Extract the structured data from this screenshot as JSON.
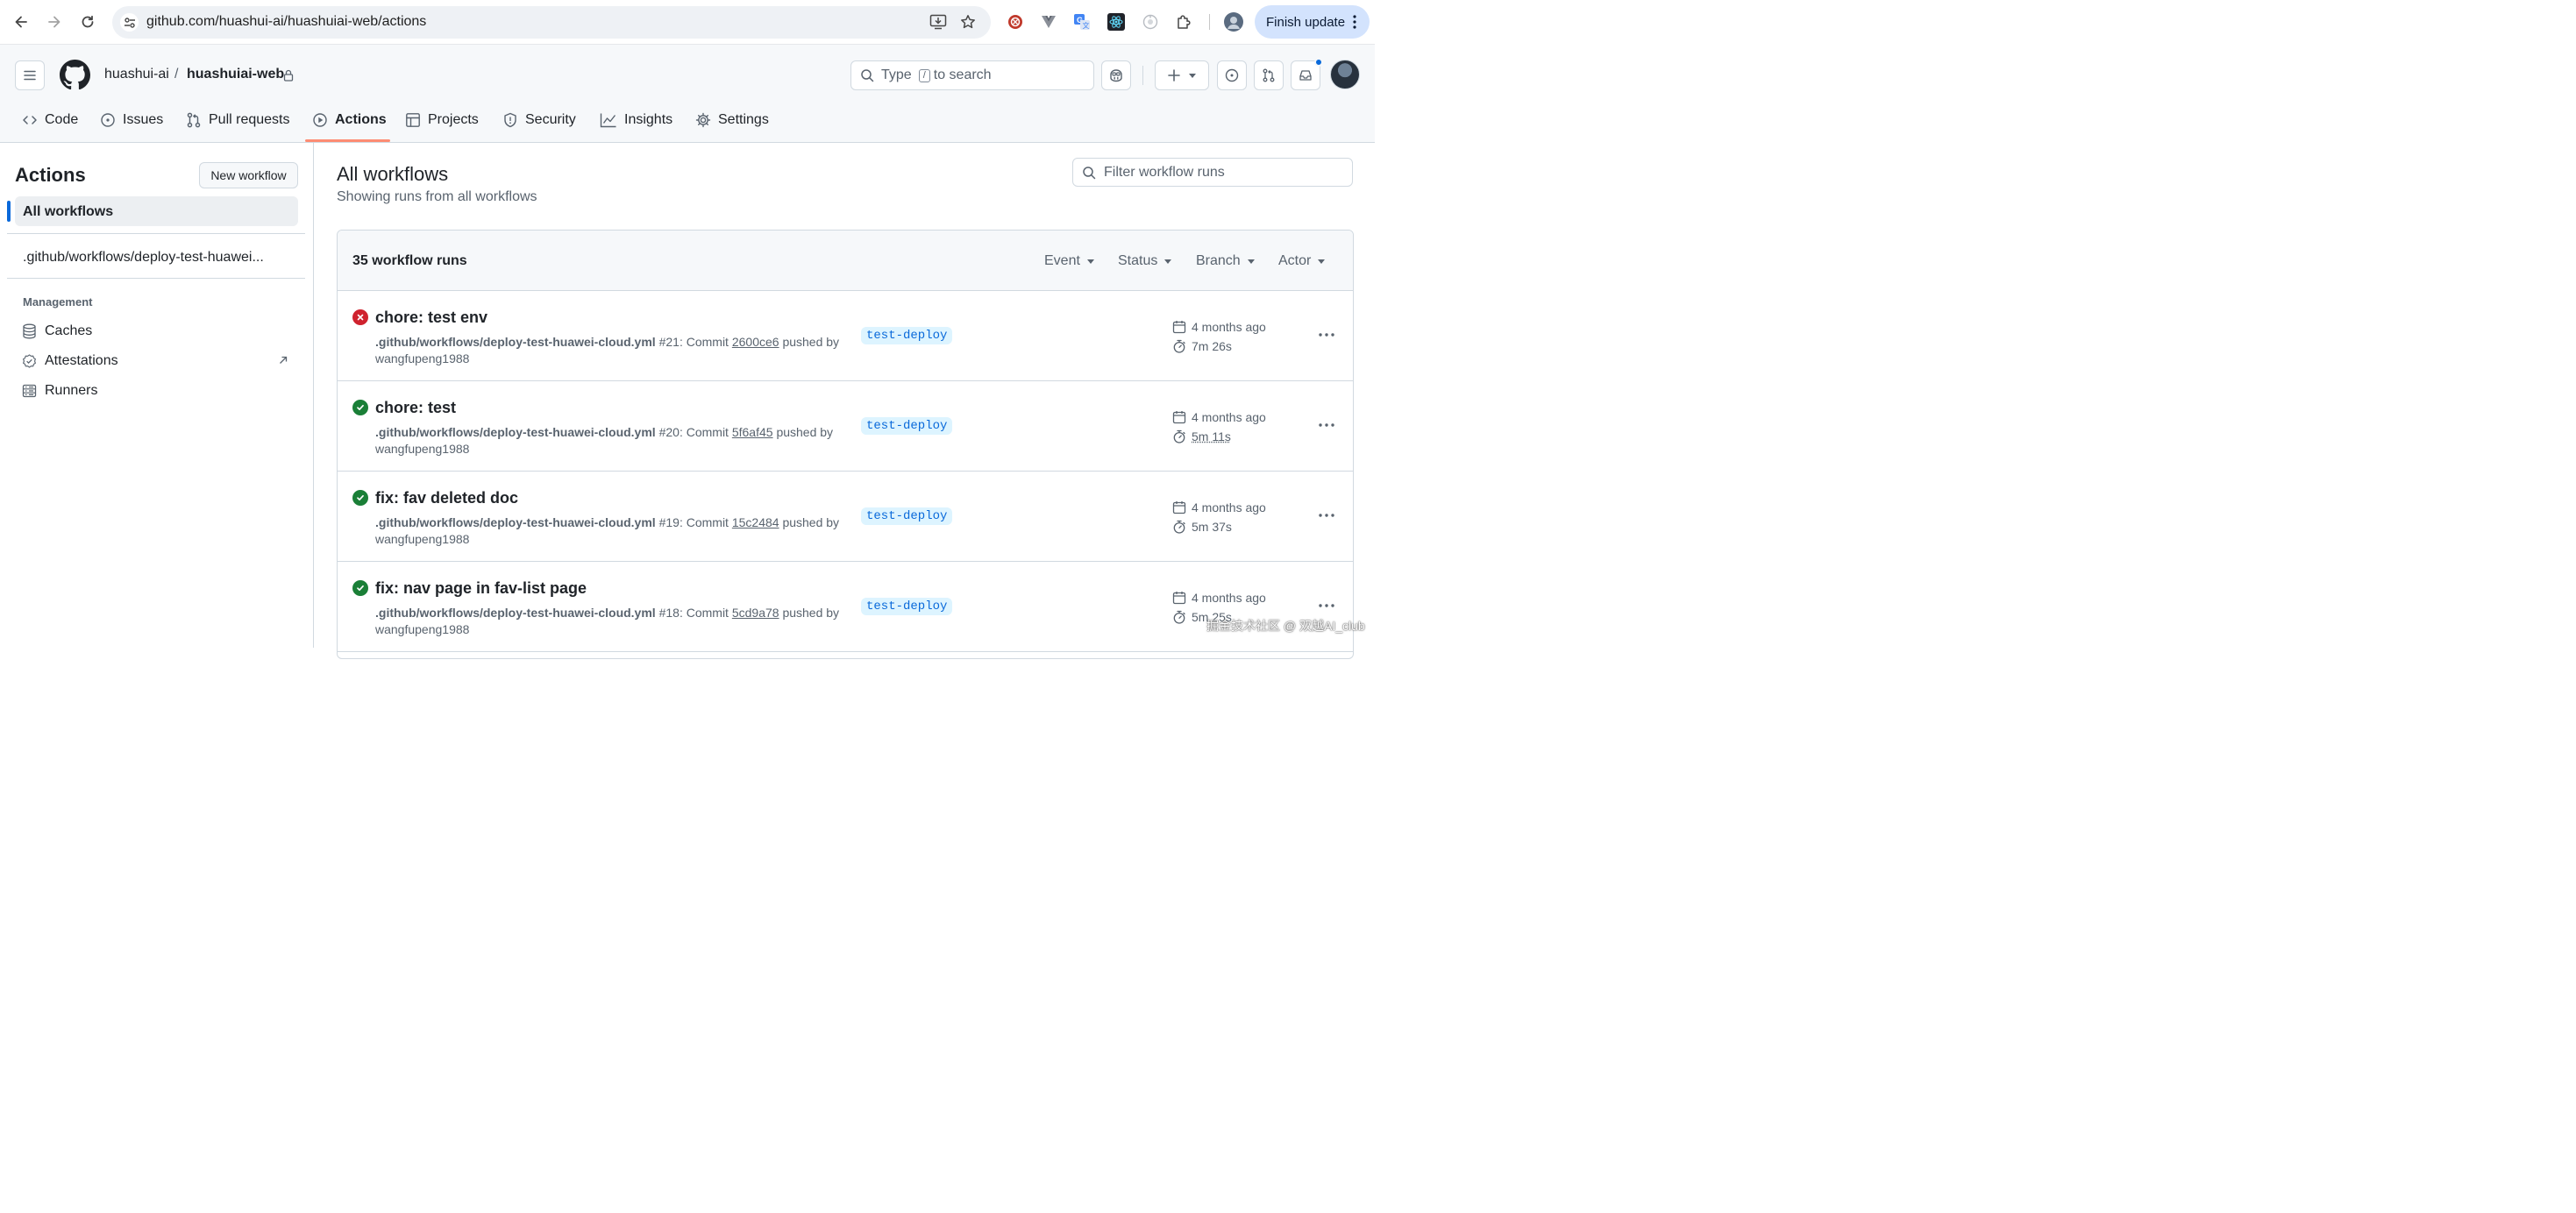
{
  "browser": {
    "url": "github.com/huashui-ai/huashuiai-web/actions",
    "finish_update_label": "Finish update"
  },
  "header": {
    "owner": "huashui-ai",
    "separator": "/",
    "repo": "huashuiai-web",
    "search_prefix": "Type",
    "search_key": "/",
    "search_suffix": "to search"
  },
  "tabs": [
    {
      "label": "Code",
      "icon": "code-icon"
    },
    {
      "label": "Issues",
      "icon": "issue-icon"
    },
    {
      "label": "Pull requests",
      "icon": "pull-request-icon"
    },
    {
      "label": "Actions",
      "icon": "play-icon",
      "active": true
    },
    {
      "label": "Projects",
      "icon": "table-icon"
    },
    {
      "label": "Security",
      "icon": "shield-icon"
    },
    {
      "label": "Insights",
      "icon": "graph-icon"
    },
    {
      "label": "Settings",
      "icon": "gear-icon"
    }
  ],
  "sidebar": {
    "title": "Actions",
    "new_workflow_label": "New workflow",
    "all_workflows_label": "All workflows",
    "workflow_item": ".github/workflows/deploy-test-huawei...",
    "management_label": "Management",
    "management_items": [
      {
        "label": "Caches",
        "icon": "database-icon"
      },
      {
        "label": "Attestations",
        "icon": "verified-icon",
        "external": true
      },
      {
        "label": "Runners",
        "icon": "server-icon"
      }
    ]
  },
  "main": {
    "title": "All workflows",
    "subtitle": "Showing runs from all workflows",
    "filter_placeholder": "Filter workflow runs",
    "runs_count": "35 workflow runs",
    "filters": [
      "Event",
      "Status",
      "Branch",
      "Actor"
    ],
    "runs": [
      {
        "title": "chore: test env",
        "status": "failure",
        "workflow": ".github/workflows/deploy-test-huawei-cloud.yml",
        "number": "#21",
        "commit_label": "Commit",
        "sha": "2600ce6",
        "pushed_by": "pushed by",
        "actor": "wangfupeng1988",
        "branch": "test-deploy",
        "when": "4 months ago",
        "duration": "7m 26s"
      },
      {
        "title": "chore: test",
        "status": "success",
        "workflow": ".github/workflows/deploy-test-huawei-cloud.yml",
        "number": "#20",
        "commit_label": "Commit",
        "sha": "5f6af45",
        "pushed_by": "pushed by",
        "actor": "wangfupeng1988",
        "branch": "test-deploy",
        "when": "4 months ago",
        "duration": "5m 11s"
      },
      {
        "title": "fix: fav deleted doc",
        "status": "success",
        "workflow": ".github/workflows/deploy-test-huawei-cloud.yml",
        "number": "#19",
        "commit_label": "Commit",
        "sha": "15c2484",
        "pushed_by": "pushed by",
        "actor": "wangfupeng1988",
        "branch": "test-deploy",
        "when": "4 months ago",
        "duration": "5m 37s"
      },
      {
        "title": "fix: nav page in fav-list page",
        "status": "success",
        "workflow": ".github/workflows/deploy-test-huawei-cloud.yml",
        "number": "#18",
        "commit_label": "Commit",
        "sha": "5cd9a78",
        "pushed_by": "pushed by",
        "actor": "wangfupeng1988",
        "branch": "test-deploy",
        "when": "4 months ago",
        "duration": "5m 25s"
      }
    ]
  },
  "watermark": "掘金技术社区 @ 双越AI_club",
  "colors": {
    "failure": "#cf222e",
    "success": "#1a7f37",
    "accent": "#0969da",
    "tab_underline": "#fd8c73"
  }
}
